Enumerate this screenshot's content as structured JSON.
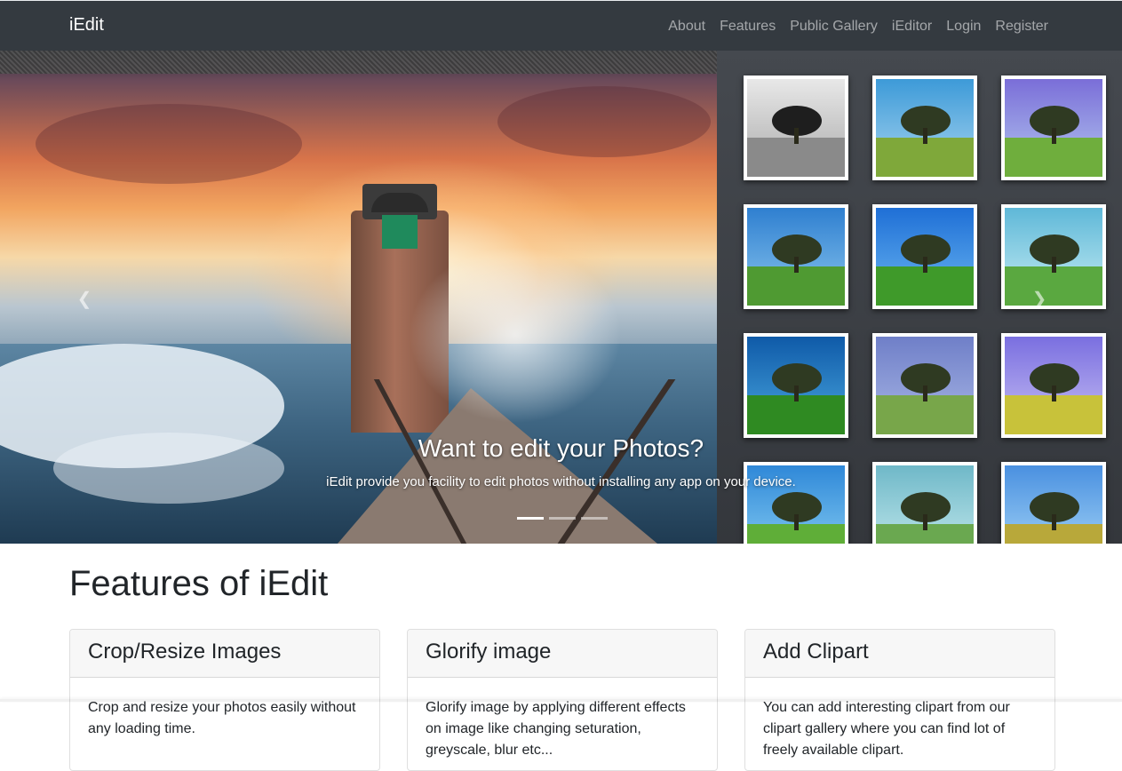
{
  "navbar": {
    "brand": "iEdit",
    "links": [
      "About",
      "Features",
      "Public Gallery",
      "iEditor",
      "Login",
      "Register"
    ]
  },
  "carousel": {
    "caption_title": "Want to edit your Photos?",
    "caption_text": "iEdit provide you facility to edit photos without installing any app on your device.",
    "prev_label": "Previous",
    "next_label": "Next",
    "slide_count": 3,
    "active_slide": 1
  },
  "features": {
    "title": "Features of iEdit",
    "cards": [
      {
        "title": "Crop/Resize Images",
        "text": "Crop and resize your photos easily without any loading time."
      },
      {
        "title": "Glorify image",
        "text": "Glorify image by applying different effects on image like changing seturation, greyscale, blur etc..."
      },
      {
        "title": "Add Clipart",
        "text": "You can add interesting clipart from our clipart gallery where you can find lot of freely available clipart."
      }
    ]
  },
  "colors": {
    "navbar_bg": "#343a40",
    "card_header_bg": "#f7f7f7"
  }
}
